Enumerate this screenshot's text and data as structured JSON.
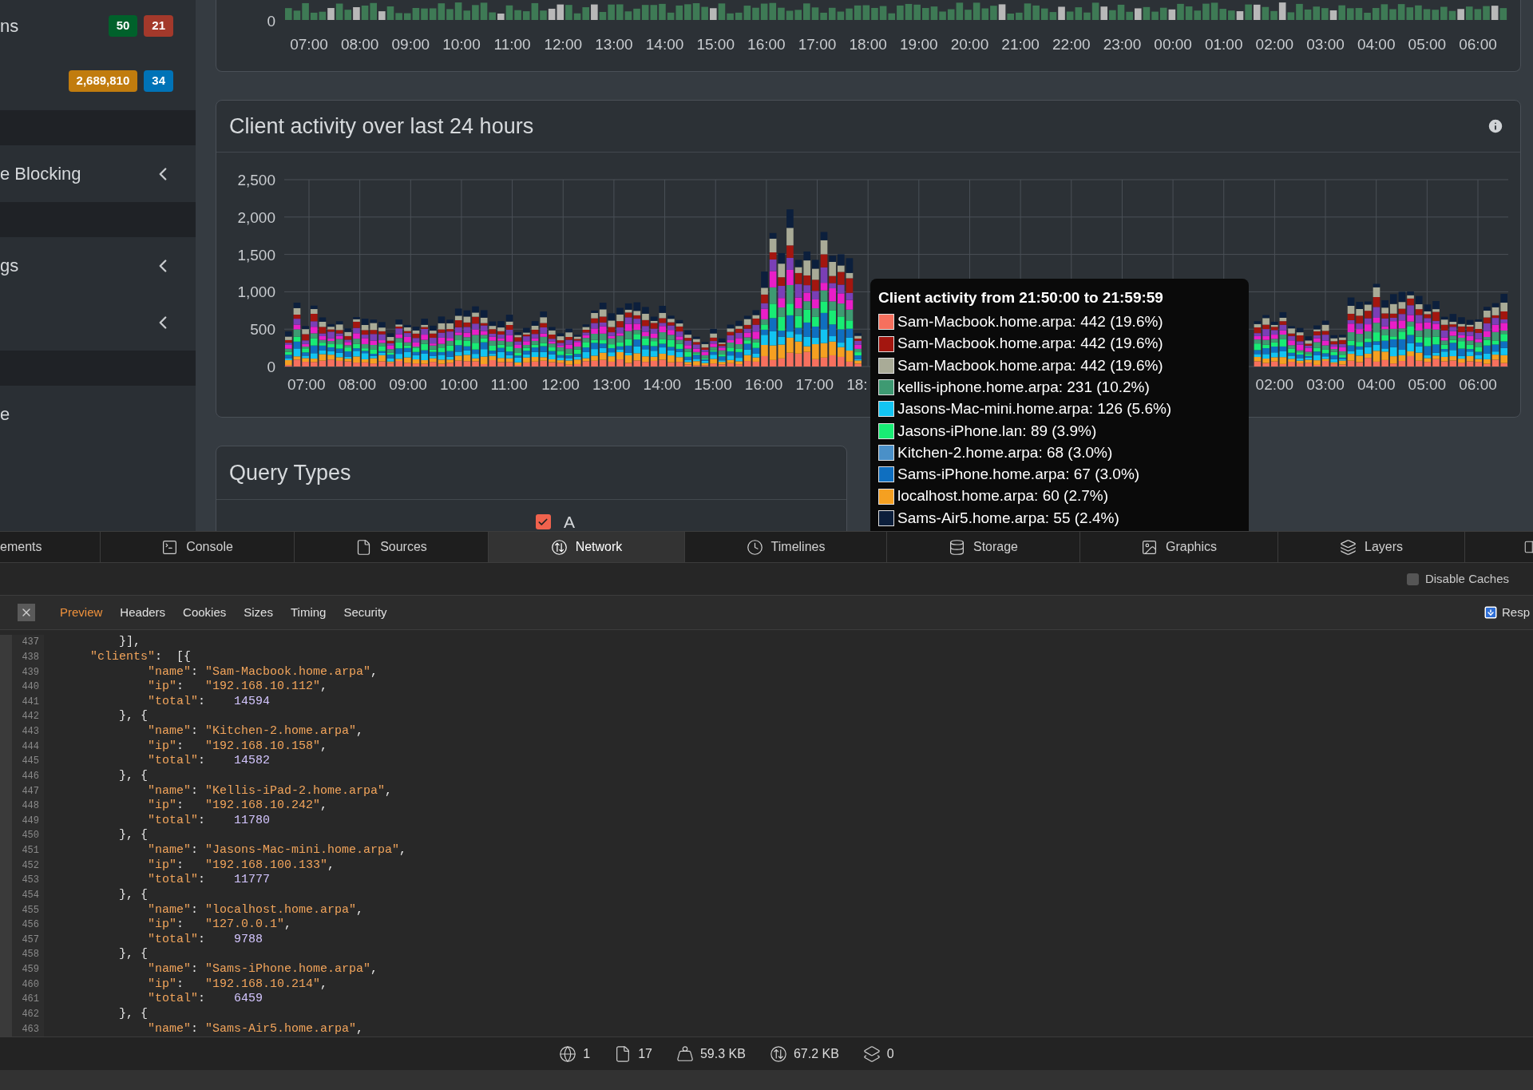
{
  "sidebar": {
    "items": [
      {
        "kind": "item",
        "label": "ns",
        "badges": [
          {
            "text": "50",
            "color": "#00612b"
          },
          {
            "text": "21",
            "color": "#a3392b"
          }
        ]
      },
      {
        "kind": "item",
        "badges": [
          {
            "text": "2,689,810",
            "color": "#c17c0e"
          },
          {
            "text": "34",
            "color": "#0073b7"
          }
        ]
      },
      {
        "kind": "header"
      },
      {
        "kind": "group",
        "label": "e Blocking"
      },
      {
        "kind": "header"
      },
      {
        "kind": "group",
        "label": "gs"
      },
      {
        "kind": "group"
      },
      {
        "kind": "header"
      },
      {
        "kind": "item",
        "label": "e"
      }
    ]
  },
  "top_chart": {
    "y_labels": [
      "0"
    ],
    "x_labels": [
      "07:00",
      "08:00",
      "09:00",
      "10:00",
      "11:00",
      "12:00",
      "13:00",
      "14:00",
      "15:00",
      "16:00",
      "17:00",
      "18:00",
      "19:00",
      "20:00",
      "21:00",
      "22:00",
      "23:00",
      "00:00",
      "01:00",
      "02:00",
      "03:00",
      "04:00",
      "05:00",
      "06:00"
    ]
  },
  "client_chart": {
    "title": "Client activity over last 24 hours",
    "y_labels": [
      "2,500",
      "2,000",
      "1,500",
      "1,000",
      "500",
      "0"
    ],
    "x_labels_left": [
      "07:00",
      "08:00",
      "09:00",
      "10:00",
      "11:00",
      "12:00",
      "13:00",
      "14:00",
      "15:00",
      "16:00",
      "17:00",
      "18:"
    ],
    "x_labels_right": [
      "02:00",
      "03:00",
      "04:00",
      "05:00",
      "06:00"
    ],
    "tooltip": {
      "title": "Client activity from 21:50:00 to 21:59:59",
      "entries": [
        {
          "text": "Sam-Macbook.home.arpa: 442 (19.6%)",
          "color": "#f6705e"
        },
        {
          "text": "Sam-Macbook.home.arpa: 442 (19.6%)",
          "color": "#a3160f"
        },
        {
          "text": "Sam-Macbook.home.arpa: 442 (19.6%)",
          "color": "#a9ab97"
        },
        {
          "text": "kellis-iphone.home.arpa: 231 (10.2%)",
          "color": "#3e9a72"
        },
        {
          "text": "Jasons-Mac-mini.home.arpa: 126 (5.6%)",
          "color": "#12c4f2"
        },
        {
          "text": "Jasons-iPhone.lan: 89 (3.9%)",
          "color": "#18ec74"
        },
        {
          "text": "Kitchen-2.home.arpa: 68 (3.0%)",
          "color": "#4a90c8"
        },
        {
          "text": "Sams-iPhone.home.arpa: 67 (3.0%)",
          "color": "#0f6fc0"
        },
        {
          "text": "localhost.home.arpa: 60 (2.7%)",
          "color": "#f5a021"
        },
        {
          "text": "Sams-Air5.home.arpa: 55 (2.4%)",
          "color": "#0c1f3c"
        }
      ]
    }
  },
  "query_types": {
    "title": "Query Types",
    "legend": [
      {
        "label": "A",
        "checked": true
      }
    ]
  },
  "devtools": {
    "tabs": [
      {
        "label": "ements",
        "selected": false
      },
      {
        "label": "Console",
        "selected": false
      },
      {
        "label": "Sources",
        "selected": false
      },
      {
        "label": "Network",
        "selected": true
      },
      {
        "label": "Timelines",
        "selected": false
      },
      {
        "label": "Storage",
        "selected": false
      },
      {
        "label": "Graphics",
        "selected": false
      },
      {
        "label": "Layers",
        "selected": false
      }
    ],
    "disable_caches": {
      "label": "Disable Caches",
      "checked": false
    },
    "subtabs": [
      {
        "label": "Preview",
        "selected": true
      },
      {
        "label": "Headers",
        "selected": false
      },
      {
        "label": "Cookies",
        "selected": false
      },
      {
        "label": "Sizes",
        "selected": false
      },
      {
        "label": "Timing",
        "selected": false
      },
      {
        "label": "Security",
        "selected": false
      }
    ],
    "response_button": "Resp",
    "code_lines": [
      {
        "number": "437",
        "tokens": [
          {
            "kind": "punct",
            "text": "        }],"
          }
        ]
      },
      {
        "number": "438",
        "tokens": [
          {
            "kind": "key",
            "text": "    \"clients\""
          },
          {
            "kind": "punct",
            "text": ":  [{"
          }
        ]
      },
      {
        "number": "439",
        "tokens": [
          {
            "kind": "key",
            "text": "            \"name\""
          },
          {
            "kind": "punct",
            "text": ": "
          },
          {
            "kind": "string",
            "text": "\"Sam-Macbook.home.arpa\""
          },
          {
            "kind": "punct",
            "text": ","
          }
        ]
      },
      {
        "number": "440",
        "tokens": [
          {
            "kind": "key",
            "text": "            \"ip\""
          },
          {
            "kind": "punct",
            "text": ":   "
          },
          {
            "kind": "string",
            "text": "\"192.168.10.112\""
          },
          {
            "kind": "punct",
            "text": ","
          }
        ]
      },
      {
        "number": "441",
        "tokens": [
          {
            "kind": "key",
            "text": "            \"total\""
          },
          {
            "kind": "punct",
            "text": ":    "
          },
          {
            "kind": "number",
            "text": "14594"
          }
        ]
      },
      {
        "number": "442",
        "tokens": [
          {
            "kind": "punct",
            "text": "        }, {"
          }
        ]
      },
      {
        "number": "443",
        "tokens": [
          {
            "kind": "key",
            "text": "            \"name\""
          },
          {
            "kind": "punct",
            "text": ": "
          },
          {
            "kind": "string",
            "text": "\"Kitchen-2.home.arpa\""
          },
          {
            "kind": "punct",
            "text": ","
          }
        ]
      },
      {
        "number": "444",
        "tokens": [
          {
            "kind": "key",
            "text": "            \"ip\""
          },
          {
            "kind": "punct",
            "text": ":   "
          },
          {
            "kind": "string",
            "text": "\"192.168.10.158\""
          },
          {
            "kind": "punct",
            "text": ","
          }
        ]
      },
      {
        "number": "445",
        "tokens": [
          {
            "kind": "key",
            "text": "            \"total\""
          },
          {
            "kind": "punct",
            "text": ":    "
          },
          {
            "kind": "number",
            "text": "14582"
          }
        ]
      },
      {
        "number": "446",
        "tokens": [
          {
            "kind": "punct",
            "text": "        }, {"
          }
        ]
      },
      {
        "number": "447",
        "tokens": [
          {
            "kind": "key",
            "text": "            \"name\""
          },
          {
            "kind": "punct",
            "text": ": "
          },
          {
            "kind": "string",
            "text": "\"Kellis-iPad-2.home.arpa\""
          },
          {
            "kind": "punct",
            "text": ","
          }
        ]
      },
      {
        "number": "448",
        "tokens": [
          {
            "kind": "key",
            "text": "            \"ip\""
          },
          {
            "kind": "punct",
            "text": ":   "
          },
          {
            "kind": "string",
            "text": "\"192.168.10.242\""
          },
          {
            "kind": "punct",
            "text": ","
          }
        ]
      },
      {
        "number": "449",
        "tokens": [
          {
            "kind": "key",
            "text": "            \"total\""
          },
          {
            "kind": "punct",
            "text": ":    "
          },
          {
            "kind": "number",
            "text": "11780"
          }
        ]
      },
      {
        "number": "450",
        "tokens": [
          {
            "kind": "punct",
            "text": "        }, {"
          }
        ]
      },
      {
        "number": "451",
        "tokens": [
          {
            "kind": "key",
            "text": "            \"name\""
          },
          {
            "kind": "punct",
            "text": ": "
          },
          {
            "kind": "string",
            "text": "\"Jasons-Mac-mini.home.arpa\""
          },
          {
            "kind": "punct",
            "text": ","
          }
        ]
      },
      {
        "number": "452",
        "tokens": [
          {
            "kind": "key",
            "text": "            \"ip\""
          },
          {
            "kind": "punct",
            "text": ":   "
          },
          {
            "kind": "string",
            "text": "\"192.168.100.133\""
          },
          {
            "kind": "punct",
            "text": ","
          }
        ]
      },
      {
        "number": "453",
        "tokens": [
          {
            "kind": "key",
            "text": "            \"total\""
          },
          {
            "kind": "punct",
            "text": ":    "
          },
          {
            "kind": "number",
            "text": "11777"
          }
        ]
      },
      {
        "number": "454",
        "tokens": [
          {
            "kind": "punct",
            "text": "        }, {"
          }
        ]
      },
      {
        "number": "455",
        "tokens": [
          {
            "kind": "key",
            "text": "            \"name\""
          },
          {
            "kind": "punct",
            "text": ": "
          },
          {
            "kind": "string",
            "text": "\"localhost.home.arpa\""
          },
          {
            "kind": "punct",
            "text": ","
          }
        ]
      },
      {
        "number": "456",
        "tokens": [
          {
            "kind": "key",
            "text": "            \"ip\""
          },
          {
            "kind": "punct",
            "text": ":   "
          },
          {
            "kind": "string",
            "text": "\"127.0.0.1\""
          },
          {
            "kind": "punct",
            "text": ","
          }
        ]
      },
      {
        "number": "457",
        "tokens": [
          {
            "kind": "key",
            "text": "            \"total\""
          },
          {
            "kind": "punct",
            "text": ":    "
          },
          {
            "kind": "number",
            "text": "9788"
          }
        ]
      },
      {
        "number": "458",
        "tokens": [
          {
            "kind": "punct",
            "text": "        }, {"
          }
        ]
      },
      {
        "number": "459",
        "tokens": [
          {
            "kind": "key",
            "text": "            \"name\""
          },
          {
            "kind": "punct",
            "text": ": "
          },
          {
            "kind": "string",
            "text": "\"Sams-iPhone.home.arpa\""
          },
          {
            "kind": "punct",
            "text": ","
          }
        ]
      },
      {
        "number": "460",
        "tokens": [
          {
            "kind": "key",
            "text": "            \"ip\""
          },
          {
            "kind": "punct",
            "text": ":   "
          },
          {
            "kind": "string",
            "text": "\"192.168.10.214\""
          },
          {
            "kind": "punct",
            "text": ","
          }
        ]
      },
      {
        "number": "461",
        "tokens": [
          {
            "kind": "key",
            "text": "            \"total\""
          },
          {
            "kind": "punct",
            "text": ":    "
          },
          {
            "kind": "number",
            "text": "6459"
          }
        ]
      },
      {
        "number": "462",
        "tokens": [
          {
            "kind": "punct",
            "text": "        }, {"
          }
        ]
      },
      {
        "number": "463",
        "tokens": [
          {
            "kind": "key",
            "text": "            \"name\""
          },
          {
            "kind": "punct",
            "text": ": "
          },
          {
            "kind": "string",
            "text": "\"Sams-Air5.home.arpa\""
          },
          {
            "kind": "punct",
            "text": ","
          }
        ]
      }
    ],
    "status": [
      "1",
      "17",
      "59.3 KB",
      "67.2 KB",
      "0"
    ]
  }
}
